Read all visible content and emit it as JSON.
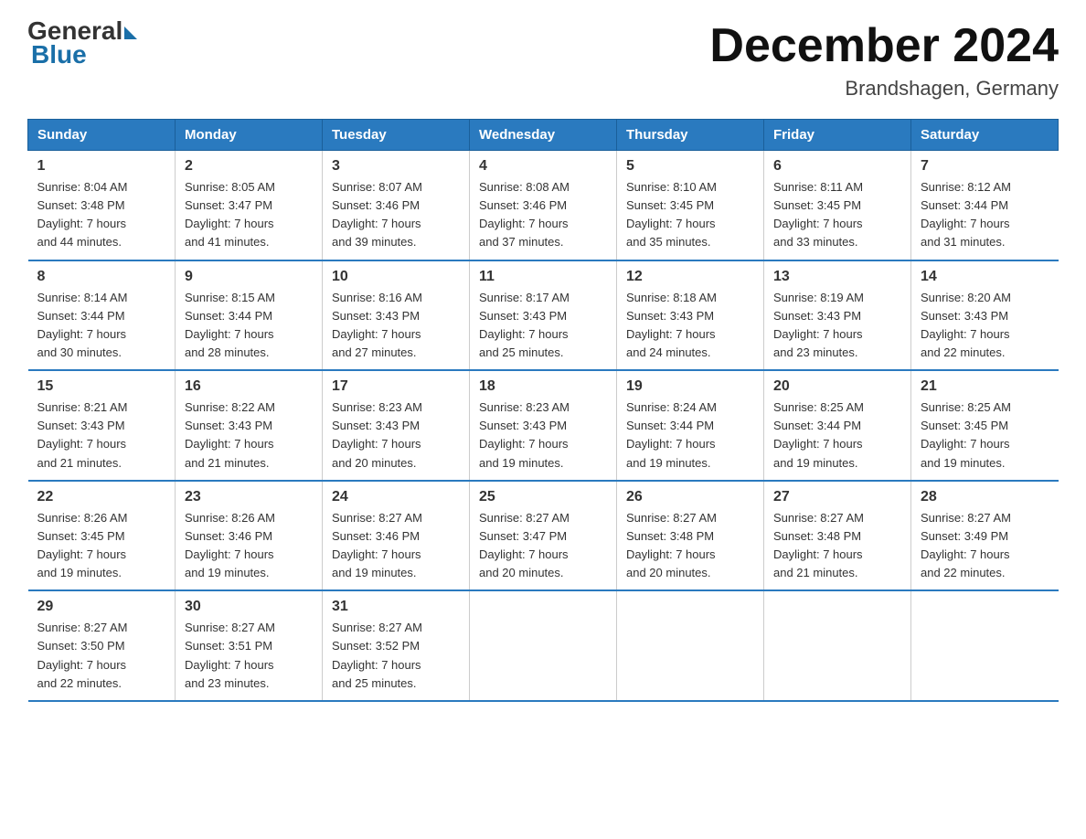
{
  "logo": {
    "general": "General",
    "blue": "Blue"
  },
  "title": "December 2024",
  "location": "Brandshagen, Germany",
  "days_of_week": [
    "Sunday",
    "Monday",
    "Tuesday",
    "Wednesday",
    "Thursday",
    "Friday",
    "Saturday"
  ],
  "weeks": [
    [
      {
        "day": "1",
        "info": "Sunrise: 8:04 AM\nSunset: 3:48 PM\nDaylight: 7 hours\nand 44 minutes."
      },
      {
        "day": "2",
        "info": "Sunrise: 8:05 AM\nSunset: 3:47 PM\nDaylight: 7 hours\nand 41 minutes."
      },
      {
        "day": "3",
        "info": "Sunrise: 8:07 AM\nSunset: 3:46 PM\nDaylight: 7 hours\nand 39 minutes."
      },
      {
        "day": "4",
        "info": "Sunrise: 8:08 AM\nSunset: 3:46 PM\nDaylight: 7 hours\nand 37 minutes."
      },
      {
        "day": "5",
        "info": "Sunrise: 8:10 AM\nSunset: 3:45 PM\nDaylight: 7 hours\nand 35 minutes."
      },
      {
        "day": "6",
        "info": "Sunrise: 8:11 AM\nSunset: 3:45 PM\nDaylight: 7 hours\nand 33 minutes."
      },
      {
        "day": "7",
        "info": "Sunrise: 8:12 AM\nSunset: 3:44 PM\nDaylight: 7 hours\nand 31 minutes."
      }
    ],
    [
      {
        "day": "8",
        "info": "Sunrise: 8:14 AM\nSunset: 3:44 PM\nDaylight: 7 hours\nand 30 minutes."
      },
      {
        "day": "9",
        "info": "Sunrise: 8:15 AM\nSunset: 3:44 PM\nDaylight: 7 hours\nand 28 minutes."
      },
      {
        "day": "10",
        "info": "Sunrise: 8:16 AM\nSunset: 3:43 PM\nDaylight: 7 hours\nand 27 minutes."
      },
      {
        "day": "11",
        "info": "Sunrise: 8:17 AM\nSunset: 3:43 PM\nDaylight: 7 hours\nand 25 minutes."
      },
      {
        "day": "12",
        "info": "Sunrise: 8:18 AM\nSunset: 3:43 PM\nDaylight: 7 hours\nand 24 minutes."
      },
      {
        "day": "13",
        "info": "Sunrise: 8:19 AM\nSunset: 3:43 PM\nDaylight: 7 hours\nand 23 minutes."
      },
      {
        "day": "14",
        "info": "Sunrise: 8:20 AM\nSunset: 3:43 PM\nDaylight: 7 hours\nand 22 minutes."
      }
    ],
    [
      {
        "day": "15",
        "info": "Sunrise: 8:21 AM\nSunset: 3:43 PM\nDaylight: 7 hours\nand 21 minutes."
      },
      {
        "day": "16",
        "info": "Sunrise: 8:22 AM\nSunset: 3:43 PM\nDaylight: 7 hours\nand 21 minutes."
      },
      {
        "day": "17",
        "info": "Sunrise: 8:23 AM\nSunset: 3:43 PM\nDaylight: 7 hours\nand 20 minutes."
      },
      {
        "day": "18",
        "info": "Sunrise: 8:23 AM\nSunset: 3:43 PM\nDaylight: 7 hours\nand 19 minutes."
      },
      {
        "day": "19",
        "info": "Sunrise: 8:24 AM\nSunset: 3:44 PM\nDaylight: 7 hours\nand 19 minutes."
      },
      {
        "day": "20",
        "info": "Sunrise: 8:25 AM\nSunset: 3:44 PM\nDaylight: 7 hours\nand 19 minutes."
      },
      {
        "day": "21",
        "info": "Sunrise: 8:25 AM\nSunset: 3:45 PM\nDaylight: 7 hours\nand 19 minutes."
      }
    ],
    [
      {
        "day": "22",
        "info": "Sunrise: 8:26 AM\nSunset: 3:45 PM\nDaylight: 7 hours\nand 19 minutes."
      },
      {
        "day": "23",
        "info": "Sunrise: 8:26 AM\nSunset: 3:46 PM\nDaylight: 7 hours\nand 19 minutes."
      },
      {
        "day": "24",
        "info": "Sunrise: 8:27 AM\nSunset: 3:46 PM\nDaylight: 7 hours\nand 19 minutes."
      },
      {
        "day": "25",
        "info": "Sunrise: 8:27 AM\nSunset: 3:47 PM\nDaylight: 7 hours\nand 20 minutes."
      },
      {
        "day": "26",
        "info": "Sunrise: 8:27 AM\nSunset: 3:48 PM\nDaylight: 7 hours\nand 20 minutes."
      },
      {
        "day": "27",
        "info": "Sunrise: 8:27 AM\nSunset: 3:48 PM\nDaylight: 7 hours\nand 21 minutes."
      },
      {
        "day": "28",
        "info": "Sunrise: 8:27 AM\nSunset: 3:49 PM\nDaylight: 7 hours\nand 22 minutes."
      }
    ],
    [
      {
        "day": "29",
        "info": "Sunrise: 8:27 AM\nSunset: 3:50 PM\nDaylight: 7 hours\nand 22 minutes."
      },
      {
        "day": "30",
        "info": "Sunrise: 8:27 AM\nSunset: 3:51 PM\nDaylight: 7 hours\nand 23 minutes."
      },
      {
        "day": "31",
        "info": "Sunrise: 8:27 AM\nSunset: 3:52 PM\nDaylight: 7 hours\nand 25 minutes."
      },
      {
        "day": "",
        "info": ""
      },
      {
        "day": "",
        "info": ""
      },
      {
        "day": "",
        "info": ""
      },
      {
        "day": "",
        "info": ""
      }
    ]
  ]
}
